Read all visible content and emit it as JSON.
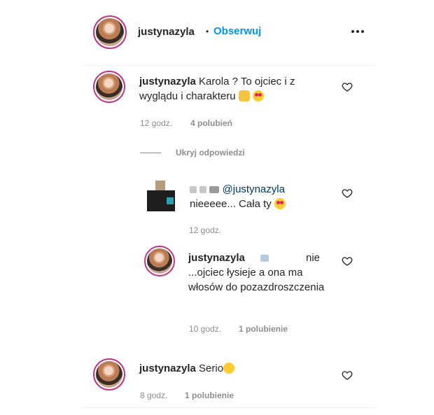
{
  "header": {
    "username": "justynazyla",
    "separator": "•",
    "follow_label": "Obserwuj",
    "more_icon": "more-horizontal-icon"
  },
  "comments": [
    {
      "username": "justynazyla",
      "text": "Karola ? To ojciec i z wyglądu i charakteru",
      "time": "12 godz.",
      "likes": "4 polubień",
      "emoji": [
        "raising-hands-icon",
        "heart-eyes-icon"
      ]
    }
  ],
  "hide_replies_label": "Ukryj odpowiedzi",
  "replies": [
    {
      "mention": "@justynazyla",
      "text": "nieeeee... Cała ty",
      "time": "12 godz.",
      "emoji": [
        "heart-eyes-icon"
      ]
    },
    {
      "username": "justynazyla",
      "text_word": "nie",
      "text": "...ojciec łysieje a ona ma włosów do pozazdroszczenia",
      "time": "10 godz.",
      "likes": "1 polubienie"
    }
  ],
  "last_comment": {
    "username": "justynazyla",
    "text": "Serio",
    "time": "8 godz.",
    "likes": "1 polubienie",
    "emoji": [
      "thinking-face-icon"
    ]
  },
  "colors": {
    "link_blue": "#0095f6",
    "meta_gray": "#8e8e8e",
    "story_ring": "#c13584"
  }
}
